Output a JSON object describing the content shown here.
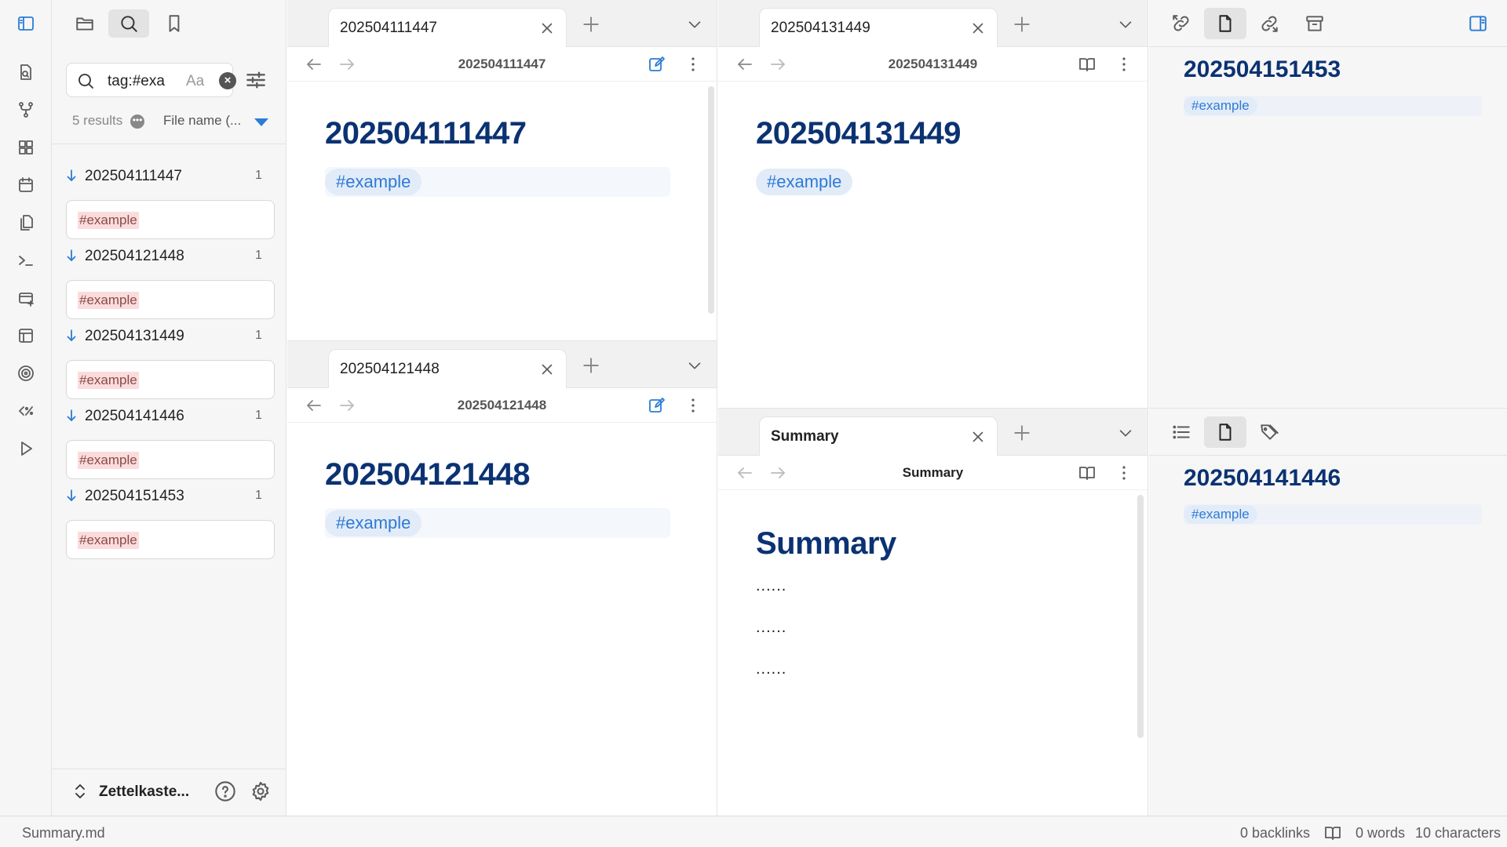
{
  "left_sidebar": {
    "tabs": [
      "files",
      "search",
      "bookmarks"
    ],
    "search": {
      "query": "tag:#exa",
      "match_case_label": "Aa"
    },
    "results_count": "5 results",
    "sort_label": "File name (...",
    "results": [
      {
        "name": "202504111447",
        "count": "1",
        "match": "#example"
      },
      {
        "name": "202504121448",
        "count": "1",
        "match": "#example"
      },
      {
        "name": "202504131449",
        "count": "1",
        "match": "#example"
      },
      {
        "name": "202504141446",
        "count": "1",
        "match": "#example"
      },
      {
        "name": "202504151453",
        "count": "1",
        "match": "#example"
      }
    ],
    "vault_name": "Zettelkaste..."
  },
  "panes": {
    "top_left": {
      "tab_label": "202504111447",
      "nav_title": "202504111447",
      "title": "202504111447",
      "tag": "#example"
    },
    "bottom_left": {
      "tab_label": "202504121448",
      "nav_title": "202504121448",
      "title": "202504121448",
      "tag": "#example"
    },
    "top_right": {
      "tab_label": "202504131449",
      "nav_title": "202504131449",
      "title": "202504131449",
      "tag": "#example"
    },
    "bottom_right": {
      "tab_label": "Summary",
      "nav_title": "Summary",
      "title": "Summary",
      "lines": [
        "......",
        "......",
        "......"
      ]
    }
  },
  "right_sidebar": {
    "top": {
      "title": "202504151453",
      "tag": "#example"
    },
    "bottom": {
      "title": "202504141446",
      "tag": "#example"
    }
  },
  "status_bar": {
    "file": "Summary.md",
    "backlinks": "0 backlinks",
    "words": "0 words",
    "characters": "10 characters"
  },
  "colors": {
    "accent": "#2a7dd6",
    "heading": "#0b3272",
    "tag_text": "#2f7ad6",
    "tag_bg": "#e2ecf8",
    "match_highlight": "#fbdcdc"
  }
}
